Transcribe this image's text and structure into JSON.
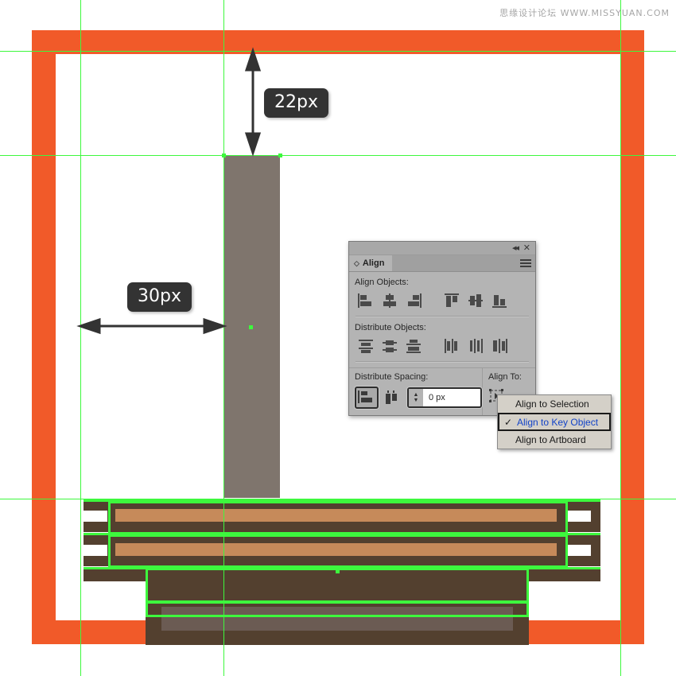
{
  "watermark": "思缘设计论坛  WWW.MISSYUAN.COM",
  "canvas": {
    "title": "Adobe Illustrator artboard",
    "background_color": "#FFFFFF",
    "frame_color": "#F15A29",
    "pole_color": "#7F756D",
    "bench_dark_color": "#53402F",
    "bench_light_color": "#C68A5A",
    "bench_grey_color": "#6B5B53",
    "guide_color": "#3DF83D"
  },
  "measurements": [
    {
      "name": "vertical-gap",
      "label": "22px",
      "orientation": "vertical"
    },
    {
      "name": "horizontal-gap",
      "label": "30px",
      "orientation": "horizontal"
    }
  ],
  "panel": {
    "title": "Align",
    "titlebar": {
      "collapse_icon": "◂◂",
      "close_icon": "✕"
    },
    "tab_icon": "◇",
    "menu_icon": "hamburger-icon",
    "sections": [
      {
        "name": "align-objects",
        "label": "Align Objects:",
        "buttons": [
          "horizontal-align-left",
          "horizontal-align-center",
          "horizontal-align-right",
          "vertical-align-top",
          "vertical-align-middle",
          "vertical-align-bottom"
        ]
      },
      {
        "name": "distribute-objects",
        "label": "Distribute Objects:",
        "buttons": [
          "vertical-distribute-top",
          "vertical-distribute-center",
          "vertical-distribute-bottom",
          "horizontal-distribute-left",
          "horizontal-distribute-center",
          "horizontal-distribute-right"
        ]
      }
    ],
    "distribute_spacing": {
      "label": "Distribute Spacing:",
      "buttons": [
        "vertical-distribute-space",
        "horizontal-distribute-space"
      ],
      "value": "0 px",
      "spinner_up": "▲",
      "spinner_down": "▼"
    },
    "align_to": {
      "label": "Align To:",
      "button": "align-to-key-object-icon",
      "caret": "⌄"
    }
  },
  "dropdown": {
    "name": "align-to-menu",
    "items": [
      {
        "label": "Align to Selection",
        "checked": false,
        "selected": false
      },
      {
        "label": "Align to Key Object",
        "checked": true,
        "selected": true
      },
      {
        "label": "Align to Artboard",
        "checked": false,
        "selected": false
      }
    ],
    "check_glyph": "✓"
  }
}
